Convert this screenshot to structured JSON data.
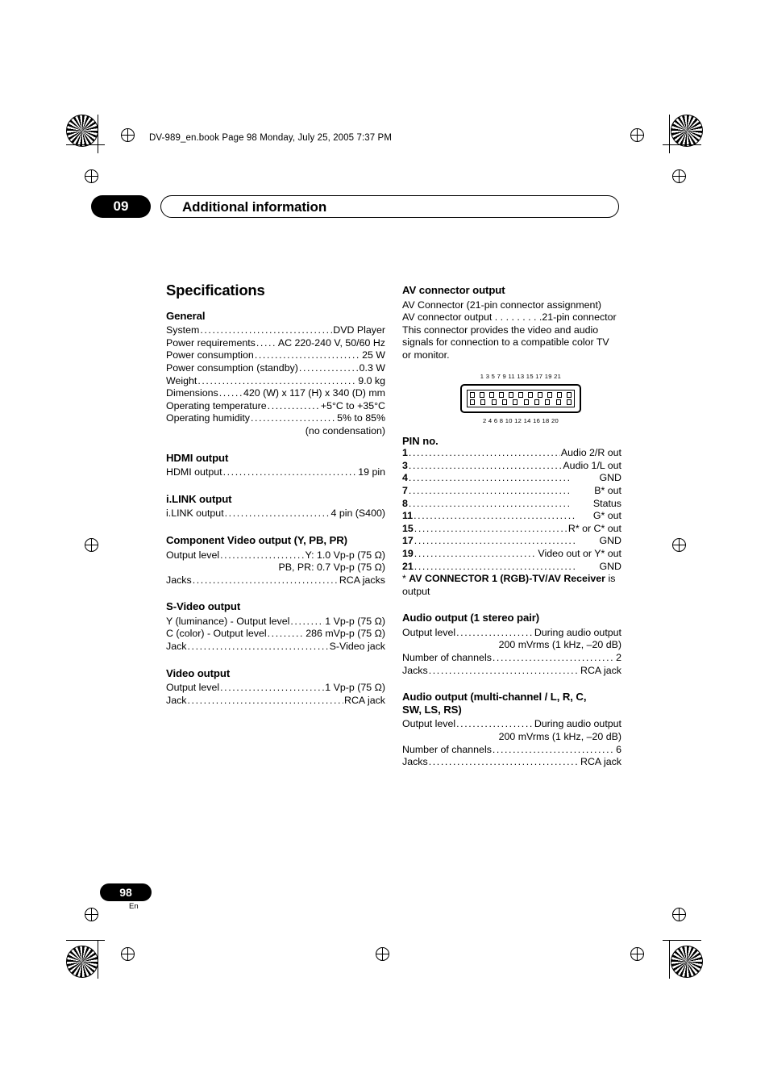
{
  "header": {
    "file_line": "DV-989_en.book  Page 98  Monday, July 25, 2005  7:37 PM"
  },
  "chapter": {
    "number": "09",
    "title": "Additional information"
  },
  "left": {
    "title": "Specifications",
    "sections": [
      {
        "heading": "General",
        "rows": [
          {
            "label": "System",
            "value": "DVD Player"
          },
          {
            "label": "Power requirements",
            "value": "AC 220-240 V, 50/60 Hz"
          },
          {
            "label": "Power consumption",
            "value": "25 W"
          },
          {
            "label": "Power consumption (standby)",
            "value": "0.3 W"
          },
          {
            "label": "Weight",
            "value": "9.0 kg"
          },
          {
            "label": "Dimensions",
            "value": "420 (W) x 117 (H) x 340 (D) mm"
          },
          {
            "label": "Operating temperature",
            "value": "+5°C to +35°C"
          },
          {
            "label": "Operating humidity",
            "value": "5% to 85%"
          }
        ],
        "trailing": "(no condensation)"
      },
      {
        "heading": "HDMI output",
        "rows": [
          {
            "label": "HDMI output",
            "value": "19 pin"
          }
        ]
      },
      {
        "heading": "i.LINK output",
        "rows": [
          {
            "label": "i.LINK output",
            "value": "4 pin (S400)"
          }
        ]
      },
      {
        "heading": "Component Video output (Y, PB, PR)",
        "rows": [
          {
            "label": "Output level",
            "value": "Y: 1.0 Vp-p (75 Ω)"
          },
          {
            "label": "Jacks",
            "value": "RCA jacks"
          }
        ],
        "mid_right": "PB, PR: 0.7 Vp-p (75 Ω)"
      },
      {
        "heading": "S-Video output",
        "rows": [
          {
            "label": "Y (luminance) - Output level",
            "value": "1 Vp-p (75 Ω)"
          },
          {
            "label": "C (color) - Output level",
            "value": "286 mVp-p (75 Ω)"
          },
          {
            "label": "Jack",
            "value": "S-Video jack"
          }
        ]
      },
      {
        "heading": "Video output",
        "rows": [
          {
            "label": "Output level",
            "value": "1 Vp-p (75 Ω)"
          },
          {
            "label": "Jack",
            "value": "RCA jack"
          }
        ]
      }
    ]
  },
  "right": {
    "av": {
      "heading": "AV connector output",
      "paragraph_lines": [
        "AV Connector (21-pin connector assignment)",
        "AV connector output . . . . . . . . .21-pin connector",
        "This connector provides the video and audio",
        "signals for connection to a compatible color TV",
        "or monitor."
      ],
      "connector_top_numbers": "1 3 5 7 9 11 13 15 17 19 21",
      "connector_bottom_numbers": "2 4 6 8 10 12 14 16 18 20",
      "pin_heading": "PIN no.",
      "pins": [
        {
          "no": "1",
          "value": "Audio 2/R out"
        },
        {
          "no": "3",
          "value": "Audio 1/L out"
        },
        {
          "no": "4",
          "value": "GND"
        },
        {
          "no": "7",
          "value": "B* out"
        },
        {
          "no": "8",
          "value": "Status"
        },
        {
          "no": "11",
          "value": "G* out"
        },
        {
          "no": "15",
          "value": "R* or C* out"
        },
        {
          "no": "17",
          "value": "GND"
        },
        {
          "no": "19",
          "value": "Video out or Y* out"
        },
        {
          "no": "21",
          "value": "GND"
        }
      ],
      "footnote_prefix": "* ",
      "footnote_bold": "AV CONNECTOR 1 (RGB)-TV/AV Receiver",
      "footnote_suffix": " is output"
    },
    "audio_stereo": {
      "heading": "Audio output (1 stereo pair)",
      "rows": [
        {
          "label": "Output level",
          "value": "During audio output"
        },
        {
          "label": "Number of channels",
          "value": "2"
        },
        {
          "label": "Jacks",
          "value": "RCA jack"
        }
      ],
      "mid_right": "200 mVrms (1 kHz, –20 dB)"
    },
    "audio_multi": {
      "heading_line1": "Audio output (multi-channel / L, R, C,",
      "heading_line2": "SW, LS, RS)",
      "rows": [
        {
          "label": "Output level",
          "value": "During audio output"
        },
        {
          "label": "Number of channels",
          "value": "6"
        },
        {
          "label": "Jacks",
          "value": "RCA jack"
        }
      ],
      "mid_right": "200 mVrms (1 kHz, –20 dB)"
    }
  },
  "footer": {
    "page_number": "98",
    "language": "En"
  }
}
